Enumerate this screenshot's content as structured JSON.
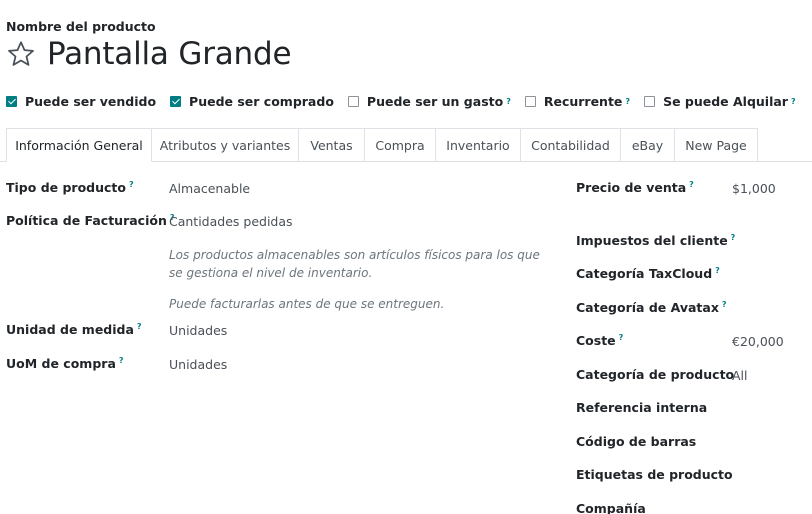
{
  "header": {
    "product_label": "Nombre del producto",
    "title": "Pantalla Grande",
    "star_icon": "star-outline-icon"
  },
  "checkboxes": [
    {
      "label": "Puede ser vendido",
      "checked": true,
      "help": ""
    },
    {
      "label": "Puede ser comprado",
      "checked": true,
      "help": ""
    },
    {
      "label": "Puede ser un gasto",
      "checked": false,
      "help": "?"
    },
    {
      "label": "Recurrente",
      "checked": false,
      "help": "?"
    },
    {
      "label": "Se puede Alquilar",
      "checked": false,
      "help": "?"
    }
  ],
  "tabs": [
    {
      "label": "Información General",
      "active": true
    },
    {
      "label": "Atributos y variantes",
      "active": false
    },
    {
      "label": "Ventas",
      "active": false
    },
    {
      "label": "Compra",
      "active": false
    },
    {
      "label": "Inventario",
      "active": false
    },
    {
      "label": "Contabilidad",
      "active": false
    },
    {
      "label": "eBay",
      "active": false
    },
    {
      "label": "New Page",
      "active": false
    }
  ],
  "left_fields": {
    "tipo_label": "Tipo de producto",
    "tipo_value": "Almacenable",
    "politica_label": "Política de Facturación",
    "politica_value": "Cantidades pedidas",
    "help_1": "Los productos almacenables son artículos físicos para los que se gestiona el nivel de inventario.",
    "help_2": "Puede facturarlas antes de que se entreguen.",
    "unidad_label": "Unidad de medida",
    "unidad_value": "Unidades",
    "uom_label": "UoM de compra",
    "uom_value": "Unidades",
    "help_mark": "?"
  },
  "right_fields": {
    "precio_label": "Precio de venta",
    "precio_value": "$1,000",
    "impuestos_label": "Impuestos del cliente",
    "taxcloud_label": "Categoría TaxCloud",
    "avatax_label": "Categoría de Avatax",
    "coste_label": "Coste",
    "coste_value": "€20,000",
    "categoria_label": "Categoría de producto",
    "categoria_value": "All",
    "referencia_label": "Referencia interna",
    "codigo_label": "Código de barras",
    "etiquetas_label": "Etiquetas de producto",
    "compania_label": "Compañía"
  },
  "colors": {
    "accent": "#017e84",
    "text": "#212529",
    "muted": "#6c757d",
    "border": "#dee2e6"
  }
}
